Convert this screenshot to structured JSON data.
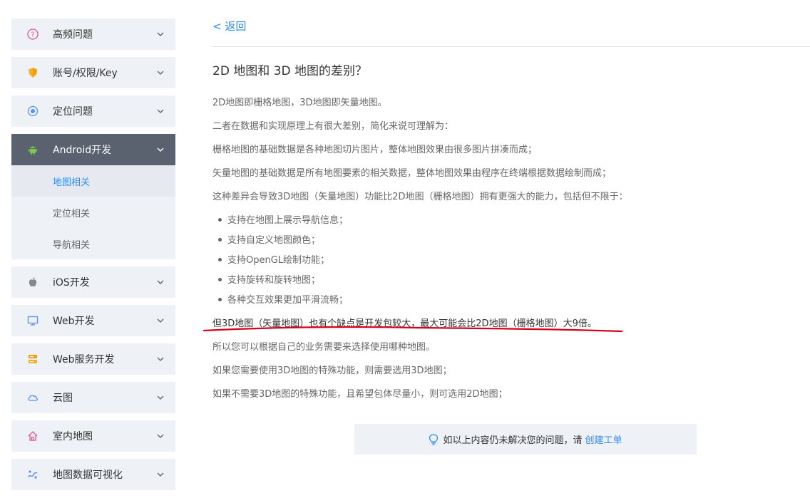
{
  "sidebar": {
    "items": [
      {
        "label": "高频问题",
        "icon": "question-icon"
      },
      {
        "label": "账号/权限/Key",
        "icon": "shield-icon"
      },
      {
        "label": "定位问题",
        "icon": "location-icon"
      },
      {
        "label": "Android开发",
        "icon": "android-icon"
      },
      {
        "label": "iOS开发",
        "icon": "apple-icon"
      },
      {
        "label": "Web开发",
        "icon": "monitor-icon"
      },
      {
        "label": "Web服务开发",
        "icon": "server-icon"
      },
      {
        "label": "云图",
        "icon": "cloud-icon"
      },
      {
        "label": "室内地图",
        "icon": "home-icon"
      },
      {
        "label": "地图数据可视化",
        "icon": "visualization-icon"
      }
    ],
    "sub_items": [
      "地图相关",
      "定位相关",
      "导航相关"
    ]
  },
  "back_label": "< 返回",
  "article": {
    "title": "2D 地图和 3D 地图的差别？",
    "paragraphs": [
      "2D地图即栅格地图，3D地图即矢量地图。",
      "二者在数据和实现原理上有很大差别，简化来说可理解为：",
      "栅格地图的基础数据是各种地图切片图片，整体地图效果由很多图片拼凑而成；",
      "矢量地图的基础数据是所有地图要素的相关数据，整体地图效果由程序在终端根据数据绘制而成；",
      "这种差异会导致3D地图（矢量地图）功能比2D地图（栅格地图）拥有更强大的能力，包括但不限于："
    ],
    "bullets": [
      "支持在地图上展示导航信息；",
      "支持自定义地图颜色；",
      "支持OpenGL绘制功能；",
      "支持旋转和旋转地图；",
      "各种交互效果更加平滑流畅；"
    ],
    "paragraphs_after": [
      "但3D地图（矢量地图）也有个缺点是开发包较大，最大可能会比2D地图（栅格地图）大9倍。",
      "所以您可以根据自己的业务需要来选择使用哪种地图。",
      "如果您需要使用3D地图的特殊功能，则需要选用3D地图；",
      "如果不需要3D地图的特殊功能，且希望包体尽量小，则可选用2D地图；"
    ]
  },
  "help": {
    "text": "如以上内容仍未解决您的问题，请",
    "link": "创建工单"
  },
  "colors": {
    "accent": "#2d8cf0",
    "sidebar_bg": "#eef1f5",
    "active_bg": "#5a6270",
    "underline": "#d9001b"
  }
}
